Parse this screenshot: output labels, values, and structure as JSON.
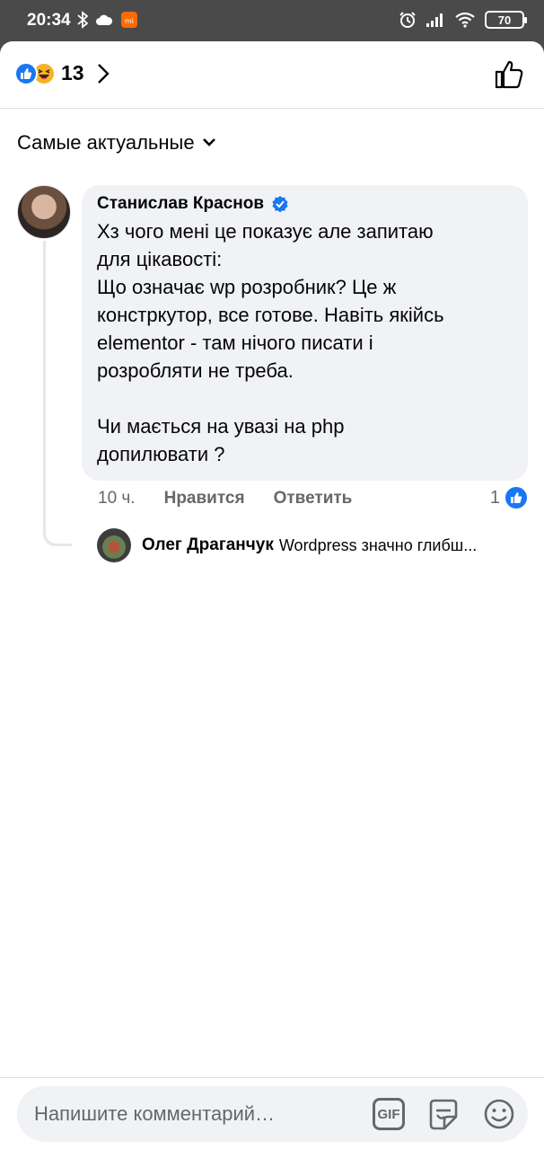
{
  "status_bar": {
    "time": "20:34",
    "battery": "70"
  },
  "reactions": {
    "count": "13",
    "types": [
      "like-icon",
      "haha-icon"
    ]
  },
  "sort": {
    "label": "Самые актуальные"
  },
  "comment": {
    "author": "Станислав Краснов",
    "verified": true,
    "text": "Хз чого мені це показує але запитаю\nдля цікавості:\nЩо означає wp розробник? Це ж\nконстркутор, все готове. Навіть якійсь\nelementor - там нічого писати і\nрозробляти не треба.\n\nЧи мається на увазі на php\nдопилювати ?",
    "time": "10 ч.",
    "like_action": "Нравится",
    "reply_action": "Ответить",
    "like_count": "1"
  },
  "reply_preview": {
    "author": "Олег Драганчук",
    "text": "Wordpress значно глибш..."
  },
  "composer": {
    "placeholder": "Напишите комментарий…",
    "gif_label": "GIF"
  },
  "colors": {
    "accent": "#1877f2",
    "bubble": "#f0f2f5",
    "secondary_text": "#65676b",
    "status_bar": "#4a4a4a"
  }
}
